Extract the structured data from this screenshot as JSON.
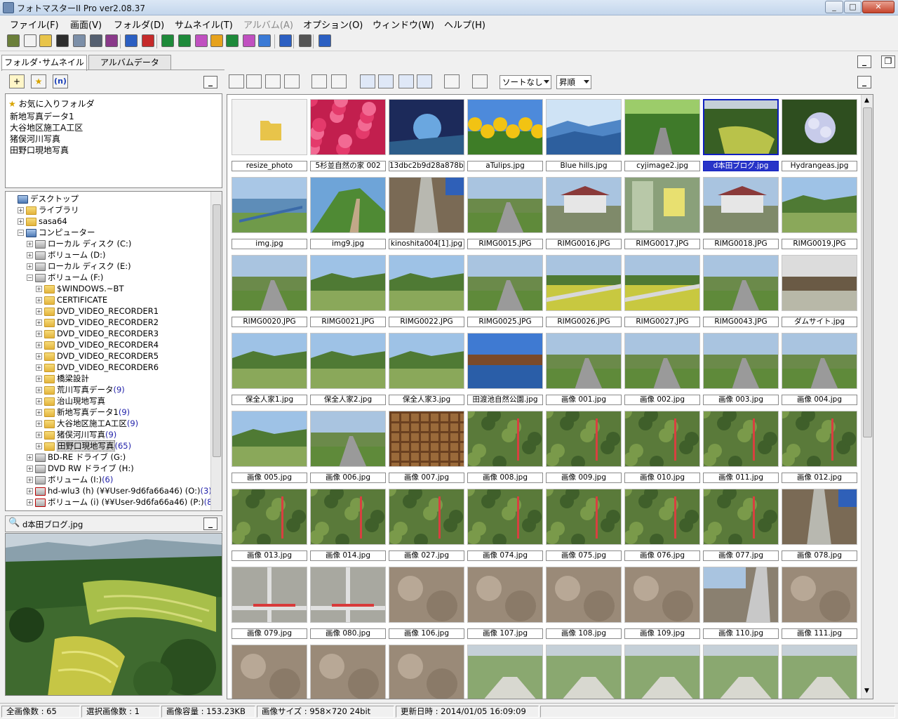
{
  "window": {
    "title": "フォトマスターII Pro ver2.08.37",
    "controls": {
      "minimize": "_",
      "maximize": "□",
      "close": "✕"
    }
  },
  "menu": [
    {
      "label": "ファイル(F)",
      "enabled": true
    },
    {
      "label": "画面(V)",
      "enabled": true
    },
    {
      "label": "フォルダ(D)",
      "enabled": true
    },
    {
      "label": "サムネイル(T)",
      "enabled": true
    },
    {
      "label": "アルバム(A)",
      "enabled": false
    },
    {
      "label": "オプション(O)",
      "enabled": true
    },
    {
      "label": "ウィンドウ(W)",
      "enabled": true
    },
    {
      "label": "ヘルプ(H)",
      "enabled": true
    }
  ],
  "toolbar": {
    "icons": [
      "import-icon",
      "new-icon",
      "open-folder-icon",
      "save-icon",
      "scan-icon",
      "print-icon",
      "print-preview-icon",
      "back-arrow-icon",
      "forward-arrow-icon",
      "layout1-icon",
      "layout2-icon",
      "layout3-icon",
      "layout4-icon",
      "layout5-icon",
      "layout6-icon",
      "layout7-icon",
      "globe-icon",
      "tools-icon",
      "help-icon"
    ]
  },
  "left_tabs": [
    {
      "label": "フォルダ･サムネイル",
      "active": true
    },
    {
      "label": "アルバムデータ",
      "active": false
    }
  ],
  "left_toolbar": {
    "new_folder_label": "+",
    "favorite_label": "★",
    "n_label": "(n)",
    "minimize_label": "_"
  },
  "favorites": {
    "header": "お気に入りフォルダ",
    "items": [
      "新地写真データ1",
      "大谷地区施工A工区",
      "猪俣河川写真",
      "田野口現地写真"
    ]
  },
  "tree": [
    {
      "label": "デスクトップ",
      "count": "",
      "indent": 0,
      "icon": "pc",
      "expander": ""
    },
    {
      "label": "ライブラリ",
      "count": "",
      "indent": 1,
      "icon": "folder",
      "expander": "+"
    },
    {
      "label": "sasa64",
      "count": "",
      "indent": 1,
      "icon": "folder",
      "expander": "+"
    },
    {
      "label": "コンピューター",
      "count": "",
      "indent": 1,
      "icon": "pc",
      "expander": "−"
    },
    {
      "label": "ローカル ディスク (C:)",
      "count": "",
      "indent": 2,
      "icon": "drive",
      "expander": "+"
    },
    {
      "label": "ボリューム (D:)",
      "count": "",
      "indent": 2,
      "icon": "drive",
      "expander": "+"
    },
    {
      "label": "ローカル ディスク (E:)",
      "count": "",
      "indent": 2,
      "icon": "drive",
      "expander": "+"
    },
    {
      "label": "ボリューム (F:)",
      "count": "",
      "indent": 2,
      "icon": "drive",
      "expander": "−"
    },
    {
      "label": "$WINDOWS.~BT",
      "count": "",
      "indent": 3,
      "icon": "folder",
      "expander": "+"
    },
    {
      "label": "CERTIFICATE",
      "count": "",
      "indent": 3,
      "icon": "folder",
      "expander": "+"
    },
    {
      "label": "DVD_VIDEO_RECORDER1",
      "count": "",
      "indent": 3,
      "icon": "folder",
      "expander": "+"
    },
    {
      "label": "DVD_VIDEO_RECORDER2",
      "count": "",
      "indent": 3,
      "icon": "folder",
      "expander": "+"
    },
    {
      "label": "DVD_VIDEO_RECORDER3",
      "count": "",
      "indent": 3,
      "icon": "folder",
      "expander": "+"
    },
    {
      "label": "DVD_VIDEO_RECORDER4",
      "count": "",
      "indent": 3,
      "icon": "folder",
      "expander": "+"
    },
    {
      "label": "DVD_VIDEO_RECORDER5",
      "count": "",
      "indent": 3,
      "icon": "folder",
      "expander": "+"
    },
    {
      "label": "DVD_VIDEO_RECORDER6",
      "count": "",
      "indent": 3,
      "icon": "folder",
      "expander": "+"
    },
    {
      "label": "橋梁設計",
      "count": "",
      "indent": 3,
      "icon": "folder",
      "expander": "+"
    },
    {
      "label": "荒川写真データ",
      "count": "(9)",
      "indent": 3,
      "icon": "folder",
      "expander": "+"
    },
    {
      "label": "治山現地写真",
      "count": "",
      "indent": 3,
      "icon": "folder",
      "expander": "+"
    },
    {
      "label": "新地写真データ1",
      "count": "(9)",
      "indent": 3,
      "icon": "folder",
      "expander": "+"
    },
    {
      "label": "大谷地区施工A工区",
      "count": "(9)",
      "indent": 3,
      "icon": "folder",
      "expander": "+"
    },
    {
      "label": "猪俣河川写真",
      "count": "(9)",
      "indent": 3,
      "icon": "folder",
      "expander": "+"
    },
    {
      "label": "田野口現地写真",
      "count": "(65)",
      "indent": 3,
      "icon": "folder",
      "expander": "+",
      "selected": true
    },
    {
      "label": "BD-RE ドライブ (G:)",
      "count": "",
      "indent": 2,
      "icon": "drive",
      "expander": "+"
    },
    {
      "label": "DVD RW ドライブ (H:)",
      "count": "",
      "indent": 2,
      "icon": "drive",
      "expander": "+"
    },
    {
      "label": "ボリューム (I:)",
      "count": "(6)",
      "indent": 2,
      "icon": "drive",
      "expander": "+"
    },
    {
      "label": "hd-wlu3 (h) (¥¥User-9d6fa66a46) (O:)",
      "count": "(3)",
      "indent": 2,
      "icon": "net",
      "expander": "+"
    },
    {
      "label": "ボリューム (i) (¥¥User-9d6fa66a46) (P:)",
      "count": "(89)",
      "indent": 2,
      "icon": "net",
      "expander": "+"
    }
  ],
  "preview": {
    "filename": "d本田ブログ.jpg",
    "minimize_label": "_"
  },
  "right_toolbar": {
    "sort_value": "ソートなし",
    "order_value": "昇順",
    "minimize_label": "_",
    "restore_label": "❐"
  },
  "thumbnails": [
    {
      "label": "resize_photo",
      "kind": "folder"
    },
    {
      "label": "5杉並自然の家 002",
      "kind": "flowers"
    },
    {
      "label": "13dbc2b9d28a878ba",
      "kind": "fantasy"
    },
    {
      "label": "aTulips.jpg",
      "kind": "tulips"
    },
    {
      "label": "Blue hills.jpg",
      "kind": "bluehills"
    },
    {
      "label": "cyjimage2.jpg",
      "kind": "forest"
    },
    {
      "label": "d本田ブログ.jpg",
      "kind": "terraces",
      "selected": true
    },
    {
      "label": "Hydrangeas.jpg",
      "kind": "hydrangea"
    },
    {
      "label": "img.jpg",
      "kind": "coast"
    },
    {
      "label": "img9.jpg",
      "kind": "mountain"
    },
    {
      "label": "kinoshita004[1].jpg",
      "kind": "ditch"
    },
    {
      "label": "RIMG0015.JPG",
      "kind": "road"
    },
    {
      "label": "RIMG0016.JPG",
      "kind": "house"
    },
    {
      "label": "RIMG0017.JPG",
      "kind": "window"
    },
    {
      "label": "RIMG0018.JPG",
      "kind": "house"
    },
    {
      "label": "RIMG0019.JPG",
      "kind": "field"
    },
    {
      "label": "RIMG0020.JPG",
      "kind": "road"
    },
    {
      "label": "RIMG0021.JPG",
      "kind": "field"
    },
    {
      "label": "RIMG0022.JPG",
      "kind": "field"
    },
    {
      "label": "RIMG0025.JPG",
      "kind": "road"
    },
    {
      "label": "RIMG0026.JPG",
      "kind": "yellowfield"
    },
    {
      "label": "RIMG0027.JPG",
      "kind": "yellowfield"
    },
    {
      "label": "RIMG0043.JPG",
      "kind": "road"
    },
    {
      "label": "ダムサイト.jpg",
      "kind": "dirt"
    },
    {
      "label": "保全人家1.jpg",
      "kind": "field"
    },
    {
      "label": "保全人家2.jpg",
      "kind": "field"
    },
    {
      "label": "保全人家3.jpg",
      "kind": "field"
    },
    {
      "label": "田渡池自然公園.jpg",
      "kind": "lake"
    },
    {
      "label": "画像 001.jpg",
      "kind": "road"
    },
    {
      "label": "画像 002.jpg",
      "kind": "road"
    },
    {
      "label": "画像 003.jpg",
      "kind": "road"
    },
    {
      "label": "画像 004.jpg",
      "kind": "road"
    },
    {
      "label": "画像 005.jpg",
      "kind": "field"
    },
    {
      "label": "画像 006.jpg",
      "kind": "road"
    },
    {
      "label": "画像 007.jpg",
      "kind": "grate"
    },
    {
      "label": "画像 008.jpg",
      "kind": "woods"
    },
    {
      "label": "画像 009.jpg",
      "kind": "woods"
    },
    {
      "label": "画像 010.jpg",
      "kind": "woods"
    },
    {
      "label": "画像 011.jpg",
      "kind": "woods"
    },
    {
      "label": "画像 012.jpg",
      "kind": "woods"
    },
    {
      "label": "画像 013.jpg",
      "kind": "woods"
    },
    {
      "label": "画像 014.jpg",
      "kind": "woods"
    },
    {
      "label": "画像 027.jpg",
      "kind": "woods"
    },
    {
      "label": "画像 074.jpg",
      "kind": "woods"
    },
    {
      "label": "画像 075.jpg",
      "kind": "woods"
    },
    {
      "label": "画像 076.jpg",
      "kind": "woods"
    },
    {
      "label": "画像 077.jpg",
      "kind": "woods"
    },
    {
      "label": "画像 078.jpg",
      "kind": "ditch"
    },
    {
      "label": "画像 079.jpg",
      "kind": "concrete"
    },
    {
      "label": "画像 080.jpg",
      "kind": "concrete"
    },
    {
      "label": "画像 106.jpg",
      "kind": "rock"
    },
    {
      "label": "画像 107.jpg",
      "kind": "rock"
    },
    {
      "label": "画像 108.jpg",
      "kind": "rock"
    },
    {
      "label": "画像 109.jpg",
      "kind": "rock"
    },
    {
      "label": "画像 110.jpg",
      "kind": "roadside"
    },
    {
      "label": "画像 111.jpg",
      "kind": "rock"
    },
    {
      "label": "",
      "kind": "rock"
    },
    {
      "label": "",
      "kind": "rock"
    },
    {
      "label": "",
      "kind": "rock"
    },
    {
      "label": "",
      "kind": "dam"
    },
    {
      "label": "",
      "kind": "dam"
    },
    {
      "label": "",
      "kind": "dam"
    },
    {
      "label": "",
      "kind": "dam"
    },
    {
      "label": "",
      "kind": "dam"
    }
  ],
  "status": {
    "total": "全画像数 : 65",
    "selected": "選択画像数 : 1",
    "size": "画像容量 : 153.23KB",
    "dimensions": "画像サイズ : 958×720 24bit",
    "updated": "更新日時 : 2014/01/05 16:09:09"
  },
  "colors": {
    "selection": "#2834c8",
    "count_text": "#2222aa"
  }
}
